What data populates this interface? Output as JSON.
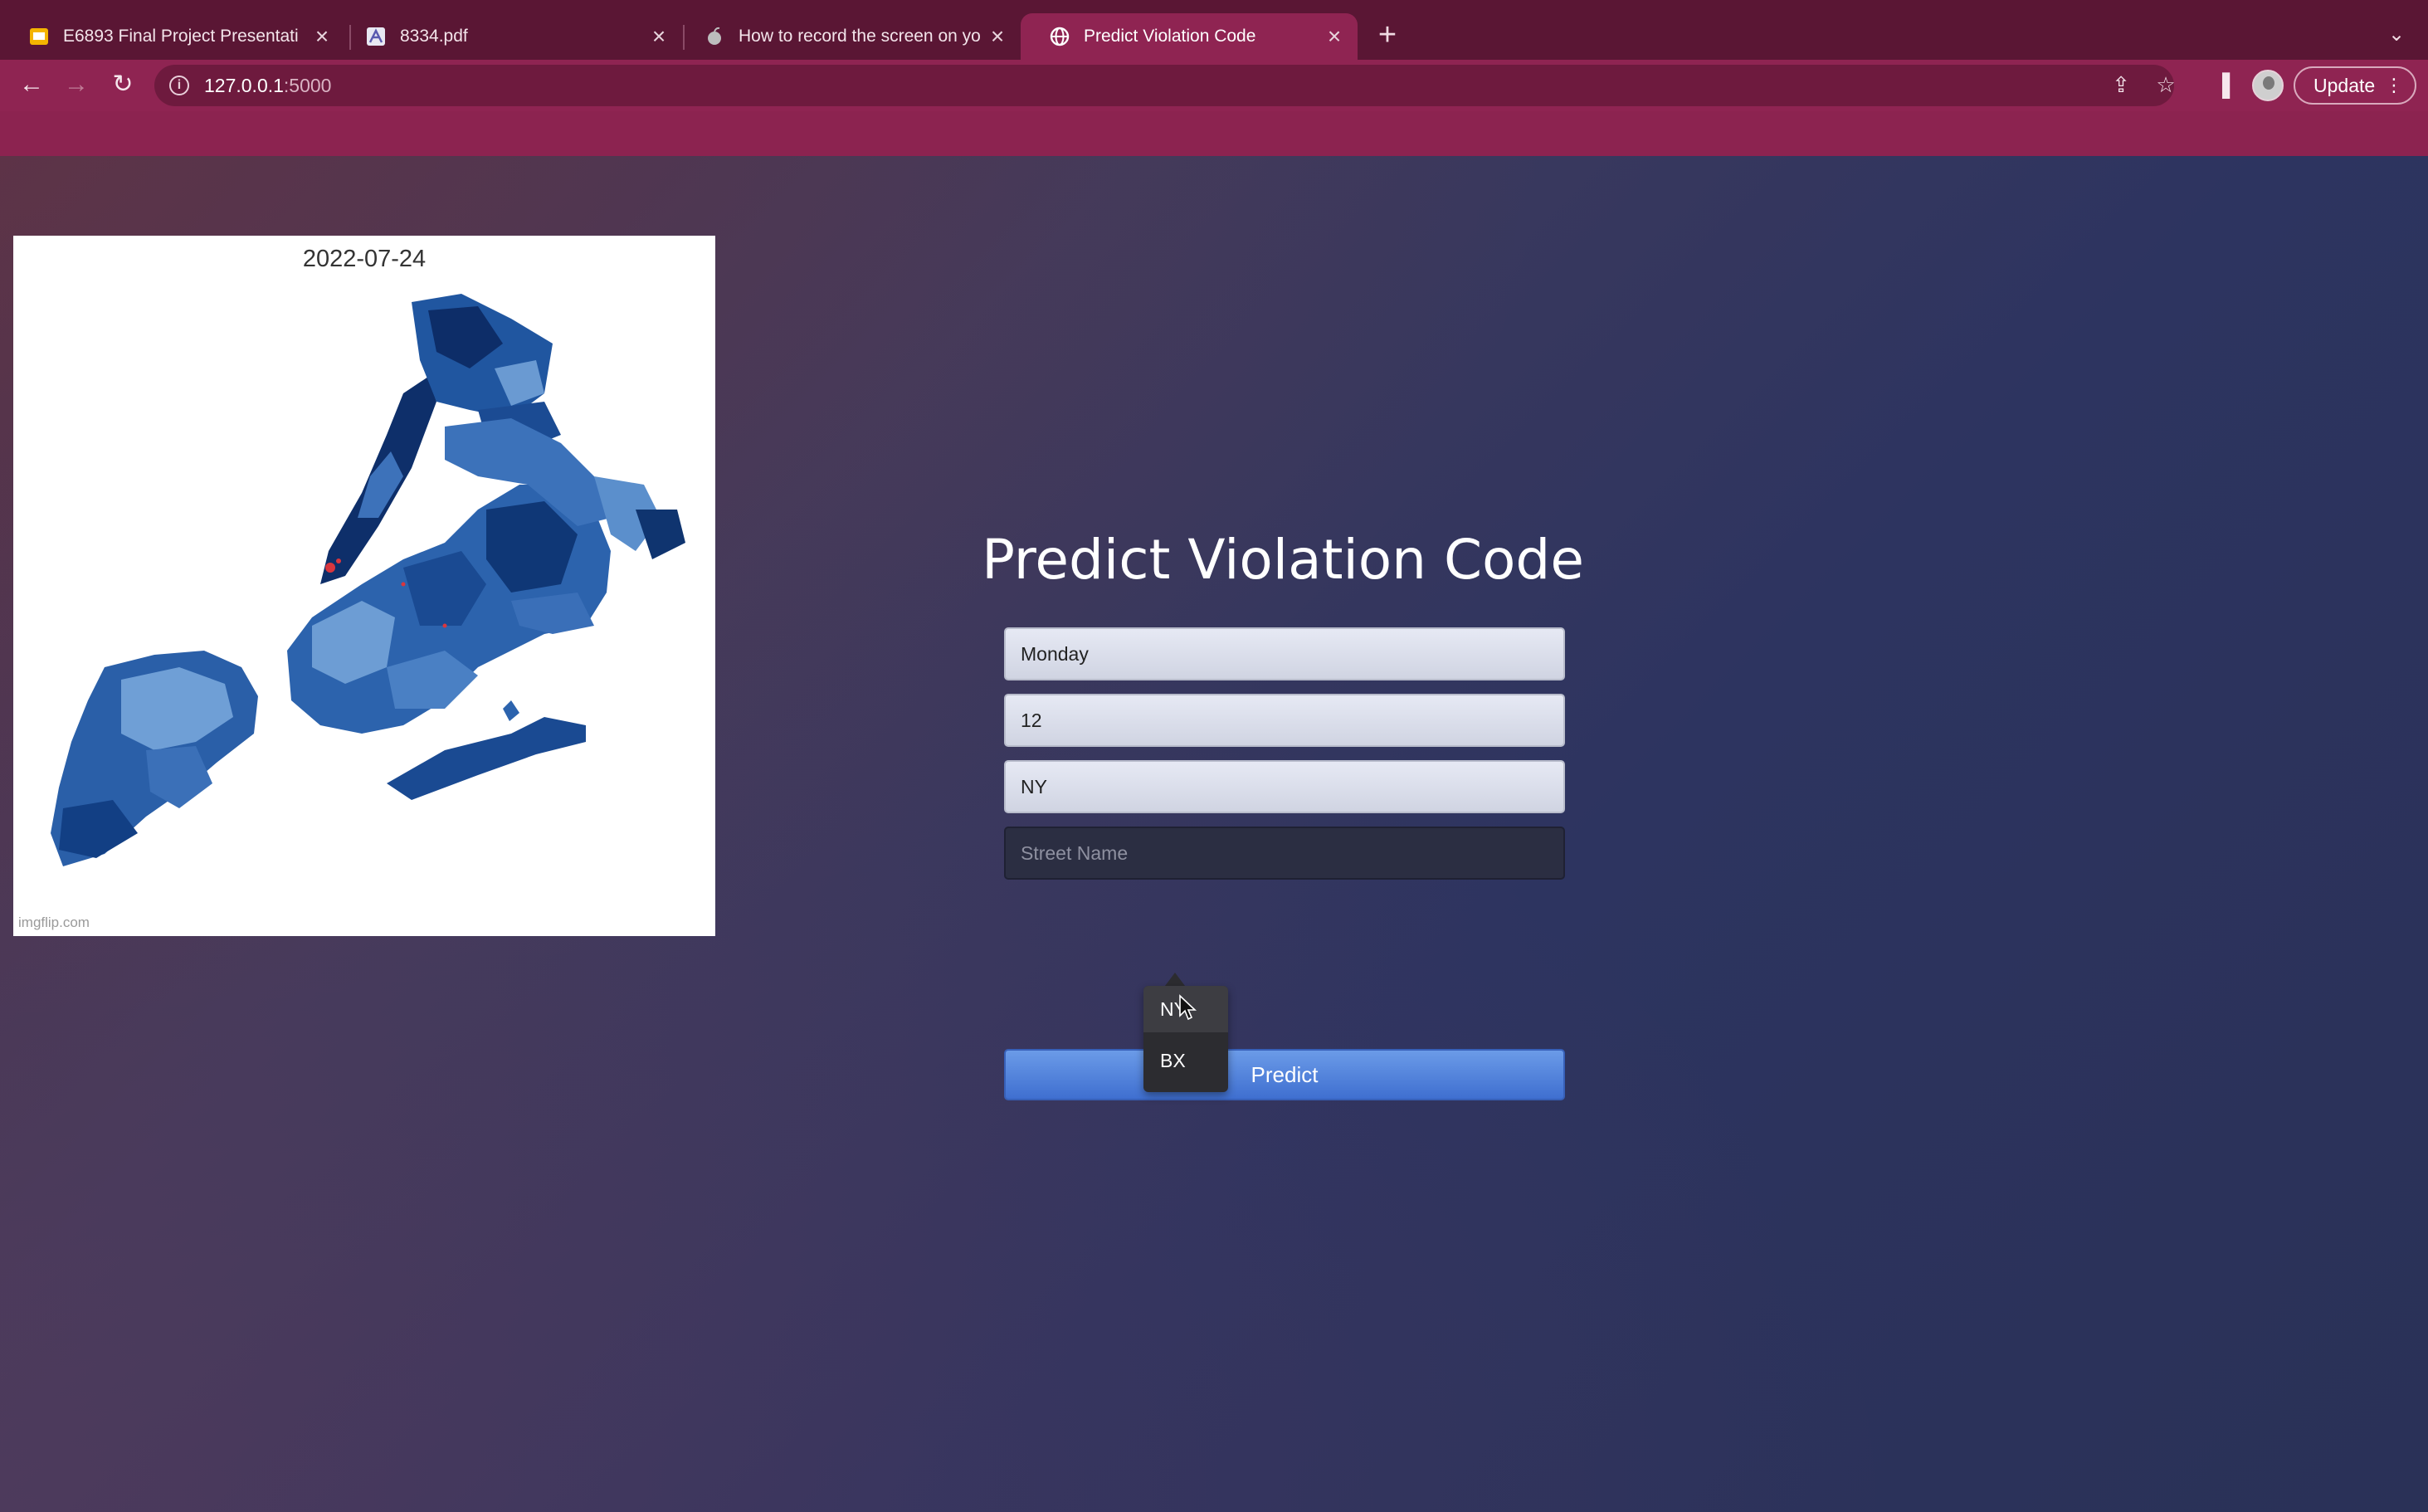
{
  "browser": {
    "tabs": [
      {
        "title": "E6893 Final Project Presentati",
        "icon": "google-slides-icon",
        "active": false
      },
      {
        "title": "8334.pdf",
        "icon": "pdf-icon",
        "active": false
      },
      {
        "title": "How to record the screen on yo",
        "icon": "apple-icon",
        "active": false
      },
      {
        "title": "Predict Violation Code",
        "icon": "globe-icon",
        "active": true
      }
    ],
    "url_host": "127.0.0.1",
    "url_port": ":5000",
    "update_label": "Update"
  },
  "map": {
    "date": "2022-07-24",
    "watermark": "imgflip.com"
  },
  "form": {
    "title": "Predict Violation Code",
    "day_value": "Monday",
    "hour_value": "12",
    "county_value": "NY",
    "street_placeholder": "Street Name",
    "predict_label": "Predict"
  },
  "dropdown": {
    "options": [
      "NY",
      "BX"
    ],
    "selected": "NY"
  },
  "colors": {
    "tabbar": "#5a1634",
    "toolbar": "#8f2452",
    "button": "#4a7ad8",
    "map_blue_dark": "#0b2f6b",
    "map_blue_light": "#8fb4dd"
  }
}
